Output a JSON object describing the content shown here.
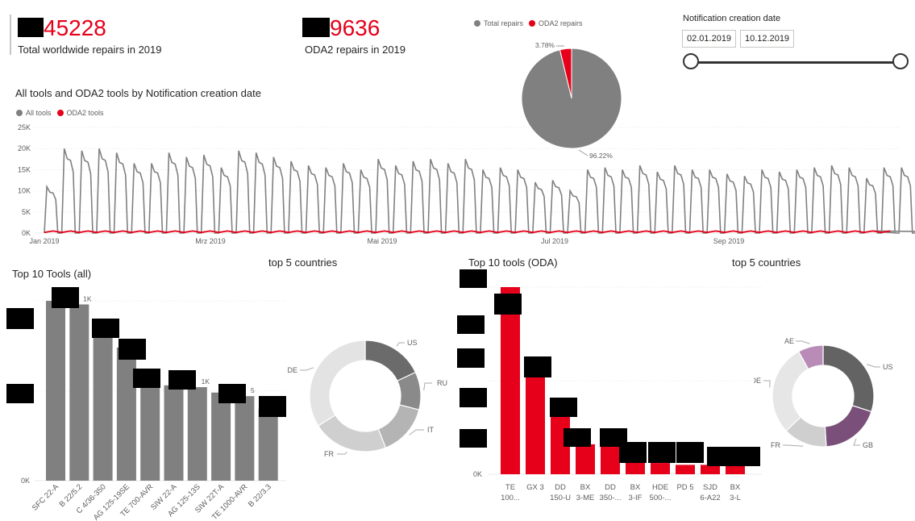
{
  "kpis": {
    "total": {
      "value": "45228",
      "label": "Total worldwide repairs in 2019"
    },
    "oda2": {
      "value": "9636",
      "label": "ODA2 repairs in 2019"
    }
  },
  "slicer": {
    "title": "Notification creation date",
    "start": "02.01.2019",
    "end": "10.12.2019"
  },
  "colors": {
    "gray": "#808080",
    "red": "#e6001a"
  },
  "pie": {
    "legend": [
      "Total repairs",
      "ODA2 repairs"
    ],
    "chart_data": {
      "type": "pie",
      "slices": [
        {
          "name": "Total repairs",
          "value": 96.22,
          "label": "96.22%"
        },
        {
          "name": "ODA2 repairs",
          "value": 3.78,
          "label": "3.78%"
        }
      ]
    }
  },
  "line": {
    "title": "All tools and ODA2 tools by Notification creation date",
    "legend": [
      "All tools",
      "ODA2 tools"
    ],
    "yticks": [
      "25K",
      "20K",
      "15K",
      "10K",
      "5K",
      "0K"
    ],
    "xticks": [
      "Jan 2019",
      "Mrz 2019",
      "Mai 2019",
      "Jul 2019",
      "Sep 2019"
    ],
    "chart_data": {
      "type": "line",
      "x_range": [
        "2019-01-02",
        "2019-12-10"
      ],
      "ylim": [
        0,
        25000
      ],
      "series": [
        {
          "name": "All tools",
          "weekly_peaks": [
            11000,
            20000,
            19500,
            20000,
            19000,
            16500,
            16500,
            19000,
            18000,
            18500,
            15500,
            19500,
            19000,
            18000,
            17000,
            16000,
            15500,
            16500,
            15000,
            17500,
            16000,
            17000,
            17500,
            16500,
            17500,
            15000,
            15500,
            15000,
            12000,
            12500,
            10000,
            15000,
            15500,
            15000,
            16000,
            14500,
            16000,
            15000,
            15000,
            14000,
            13500,
            15000,
            14500,
            15000,
            15500,
            16000,
            15500,
            13000,
            15500,
            15500,
            14500,
            15000,
            14000,
            15500,
            16000,
            14000,
            12500,
            13000,
            15500
          ],
          "trough": 0
        },
        {
          "name": "ODA2 tools",
          "level": 500
        }
      ]
    }
  },
  "top10_all": {
    "title": "Top 10 Tools (all)",
    "categories": [
      "SFC 22-A",
      "B 22/5.2",
      "C 4/36-350",
      "AG 125-19SE",
      "TE 700-AVR",
      "SIW 22-A",
      "AG 125-13S",
      "SIW 22T-A",
      "TE 1000-AVR",
      "B 22/3.3"
    ],
    "values": [
      1.0,
      0.98,
      0.84,
      0.74,
      0.62,
      0.53,
      0.52,
      0.49,
      0.47,
      0.4
    ],
    "visible_labels": [
      "1",
      "1K",
      "",
      "",
      "",
      "",
      "1K",
      "",
      "5",
      "K"
    ],
    "yticks": [
      "0K"
    ]
  },
  "donut_all": {
    "title": "top 5 countries",
    "chart_data": {
      "type": "pie",
      "slices": [
        {
          "name": "US",
          "value": 18
        },
        {
          "name": "RU",
          "value": 11
        },
        {
          "name": "IT",
          "value": 15
        },
        {
          "name": "FR",
          "value": 22
        },
        {
          "name": "DE",
          "value": 34
        }
      ]
    }
  },
  "top10_oda": {
    "title": "Top 10 tools (ODA)",
    "categories": [
      [
        "TE",
        "100..."
      ],
      [
        "GX 3",
        ""
      ],
      [
        "DD",
        "150-U"
      ],
      [
        "BX",
        "3-ME"
      ],
      [
        "DD",
        "350-..."
      ],
      [
        "BX",
        "3-IF"
      ],
      [
        "HDE",
        "500-..."
      ],
      [
        "PD 5",
        ""
      ],
      [
        "SJD",
        "6-A22"
      ],
      [
        "BX",
        "3-L"
      ]
    ],
    "values": [
      1.0,
      0.56,
      0.34,
      0.16,
      0.15,
      0.07,
      0.06,
      0.05,
      0.05,
      0.045
    ],
    "yticks": [
      "0K"
    ]
  },
  "donut_oda": {
    "title": "top 5 countries",
    "chart_data": {
      "type": "pie",
      "slices": [
        {
          "name": "US",
          "value": 30,
          "color": "#636363"
        },
        {
          "name": "GB",
          "value": 19,
          "color": "#7a4f79"
        },
        {
          "name": "FR",
          "value": 14,
          "color": "#cfcfcf"
        },
        {
          "name": "DE",
          "value": 29,
          "color": "#e6e6e6"
        },
        {
          "name": "AE",
          "value": 8,
          "color": "#b88cb7"
        }
      ]
    }
  }
}
